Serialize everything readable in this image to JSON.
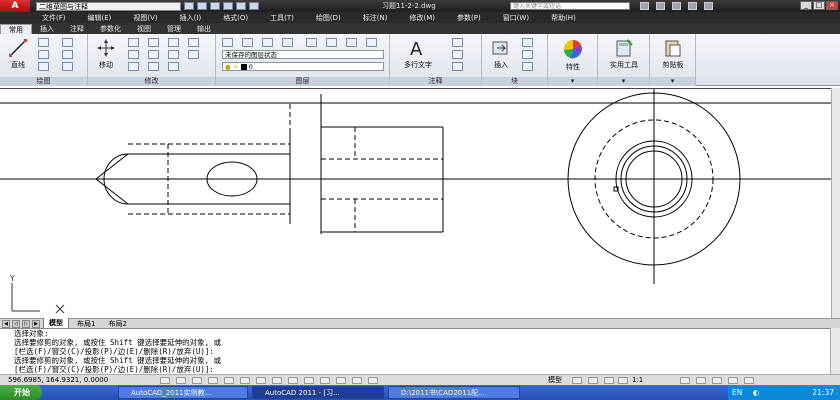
{
  "window": {
    "workspace": "二维草图与注释",
    "title": "习题11-2-2.dwg",
    "search_placeholder": "键入关键字或短语"
  },
  "menu": [
    "文件(F)",
    "编辑(E)",
    "视图(V)",
    "插入(I)",
    "格式(O)",
    "工具(T)",
    "绘图(D)",
    "标注(N)",
    "修改(M)",
    "参数(P)",
    "窗口(W)",
    "帮助(H)"
  ],
  "ribbon_tabs": [
    "常用",
    "插入",
    "注释",
    "参数化",
    "视图",
    "管理",
    "输出"
  ],
  "ribbon": {
    "draw_label": "绘图",
    "modify_label": "修改",
    "layers_label": "图层",
    "annotation_label": "注释",
    "block_label": "块",
    "line_btn": "直线",
    "move_btn": "移动",
    "layer_state": "未保存的图层状态",
    "layer_current": "0",
    "mtext_btn": "多行文字",
    "insert_btn": "插入",
    "properties_btn": "特性",
    "utilities_btn": "实用工具",
    "clipboard_btn": "剪贴板"
  },
  "layout_tabs": [
    "模型",
    "布局1",
    "布局2"
  ],
  "command_lines": [
    "选择对象:",
    "选择要修剪的对象, 或按住 Shift 键选择要延伸的对象, 或",
    "[栏选(F)/窗交(C)/投影(P)/边(E)/删除(R)/放弃(U)]:",
    "选择要修剪的对象, 或按住 Shift 键选择要延伸的对象, 或",
    "[栏选(F)/窗交(C)/投影(P)/边(E)/删除(R)/放弃(U)]:"
  ],
  "status": {
    "coords": "596.6985, 164.9321, 0.0000",
    "model": "模型",
    "scale": "1:1"
  },
  "taskbar": {
    "start": "开始",
    "tasks": [
      "AutoCAD_2011实例教...",
      "AutoCAD 2011 - [习...",
      "D:\\2011书\\CAD2011配..."
    ],
    "lang": "EN",
    "time": "21:37"
  }
}
